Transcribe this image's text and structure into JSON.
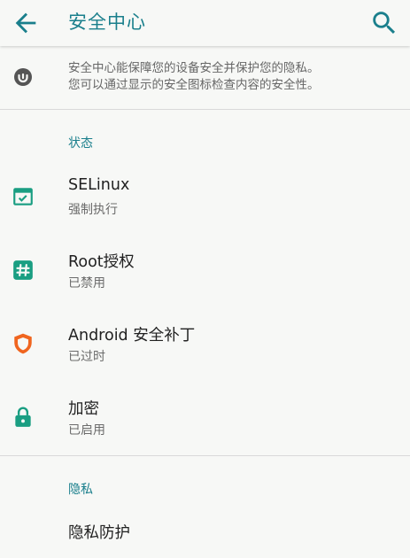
{
  "appbar": {
    "title": "安全中心"
  },
  "info": {
    "line1": "安全中心能保障您的设备安全并保护您的隐私。",
    "line2": "您可以通过显示的安全图标检查内容的安全性。"
  },
  "status_section": {
    "header": "状态",
    "items": [
      {
        "title": "SELinux",
        "subtitle": "强制执行",
        "icon_color": "#1a9e82"
      },
      {
        "title": "Root授权",
        "subtitle": "已禁用",
        "icon_color": "#1a9e82"
      },
      {
        "title": "Android 安全补丁",
        "subtitle": "已过时",
        "icon_color": "#f0651f"
      },
      {
        "title": "加密",
        "subtitle": "已启用",
        "icon_color": "#1a9e82"
      }
    ]
  },
  "privacy_section": {
    "header": "隐私",
    "items": [
      {
        "title": "隐私防护"
      }
    ]
  },
  "colors": {
    "accent": "#1a7f8c",
    "ok": "#1a9e82",
    "warning": "#f0651f"
  }
}
